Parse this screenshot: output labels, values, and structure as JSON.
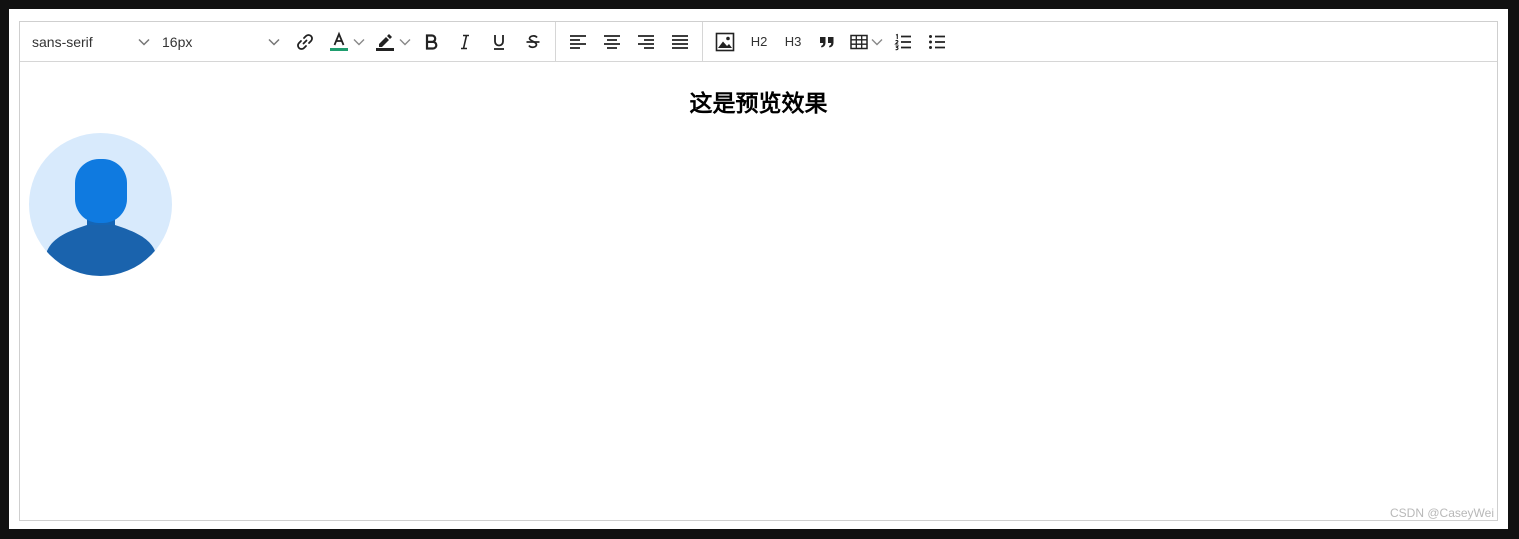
{
  "toolbar": {
    "font_family": "sans-serif",
    "font_size": "16px",
    "h2_label": "H2",
    "h3_label": "H3",
    "text_color": "#1f9d6e",
    "highlight_color": "#222222"
  },
  "content": {
    "heading": "这是预览效果",
    "image_icon": "user-avatar-icon"
  },
  "watermark": "CSDN @CaseyWei"
}
